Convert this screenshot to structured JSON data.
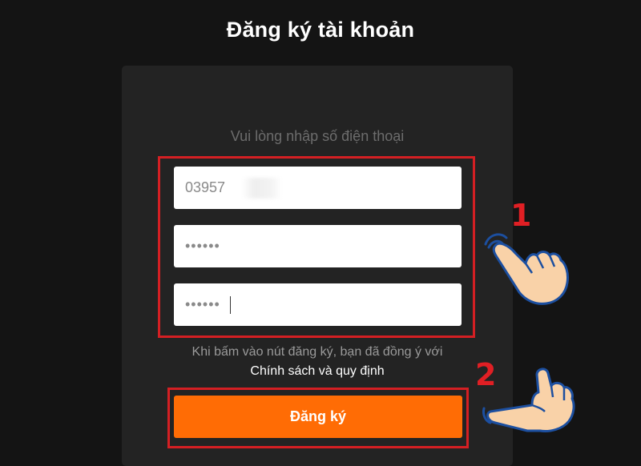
{
  "page": {
    "title": "Đăng ký tài khoản"
  },
  "form": {
    "instruction": "Vui lòng nhập số điện thoại",
    "phone_value": "03957",
    "password_value": "••••••",
    "confirm_password_value": "••••••",
    "terms_text": "Khi bấm vào nút đăng ký, bạn đã đồng ý với",
    "policy_link": "Chính sách và quy định",
    "submit_label": "Đăng ký"
  },
  "annotations": {
    "step1": "1",
    "step2": "2",
    "highlight_color": "#d41f23"
  },
  "colors": {
    "background": "#141414",
    "card": "#232323",
    "accent": "#ff6c05"
  },
  "icons": [
    "tap-hand-icon",
    "point-hand-icon"
  ]
}
